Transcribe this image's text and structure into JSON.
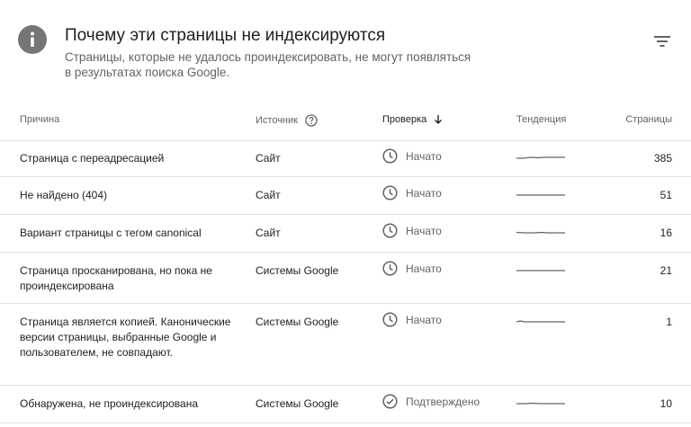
{
  "header": {
    "title": "Почему эти страницы не индексируются",
    "subtitle": "Страницы, которые не удалось проиндексировать, не могут появляться в результатах поиска Google.",
    "info_icon": "info-icon",
    "filter_icon": "filter-icon"
  },
  "table": {
    "columns": {
      "reason": "Причина",
      "source": "Источник",
      "check": "Проверка",
      "trend": "Тенденция",
      "pages": "Страницы"
    },
    "rows": [
      {
        "reason": "Страница с переадресацией",
        "source": "Сайт",
        "status": "Начато",
        "status_icon": "clock-icon",
        "pages": "385"
      },
      {
        "reason": "Не найдено (404)",
        "source": "Сайт",
        "status": "Начато",
        "status_icon": "clock-icon",
        "pages": "51"
      },
      {
        "reason": "Вариант страницы с тегом canonical",
        "source": "Сайт",
        "status": "Начато",
        "status_icon": "clock-icon",
        "pages": "16"
      },
      {
        "reason": "Страница просканирована, но пока не проиндексирована",
        "source": "Системы Google",
        "status": "Начато",
        "status_icon": "clock-icon",
        "pages": "21"
      },
      {
        "reason": "Страница является копией. Канонические версии страницы, выбранные Google и пользователем, не совпадают.",
        "source": "Системы Google",
        "status": "Начато",
        "status_icon": "clock-icon",
        "pages": "1"
      },
      {
        "reason": "Обнаружена, не проиндексирована",
        "source": "Системы Google",
        "status": "Подтверждено",
        "status_icon": "check-circle-icon",
        "pages": "10"
      }
    ]
  }
}
